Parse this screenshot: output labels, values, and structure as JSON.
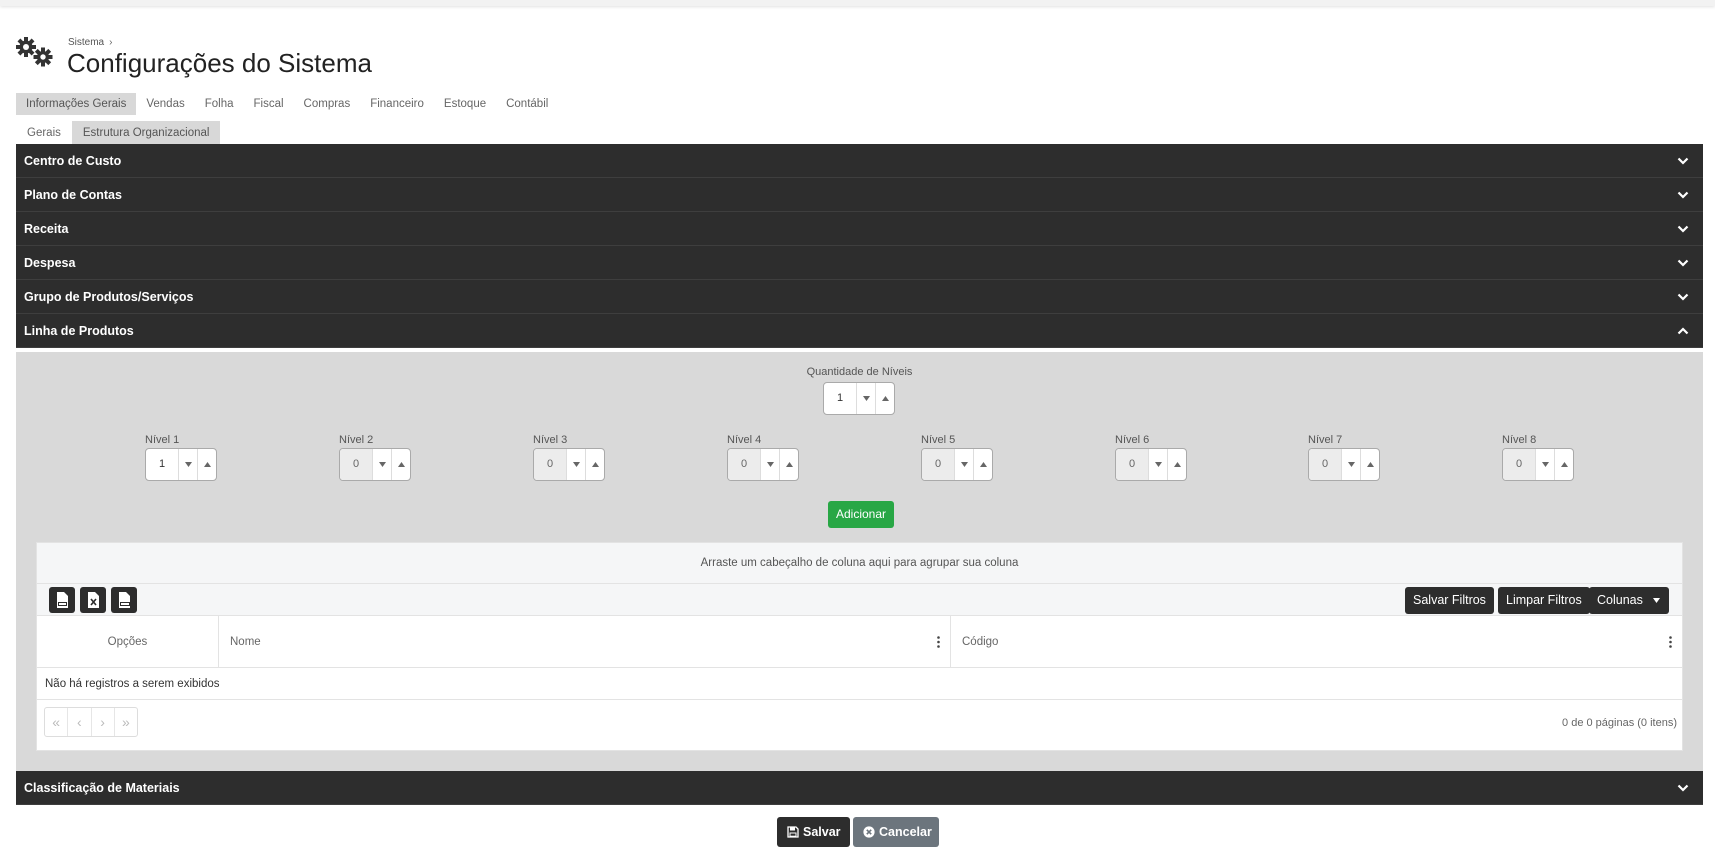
{
  "header": {
    "breadcrumb": "Sistema",
    "breadcrumb_sep": "›",
    "title": "Configurações do Sistema"
  },
  "tabs": [
    "Informações Gerais",
    "Vendas",
    "Folha",
    "Fiscal",
    "Compras",
    "Financeiro",
    "Estoque",
    "Contábil"
  ],
  "subtabs": [
    "Gerais",
    "Estrutura Organizacional"
  ],
  "sections": [
    "Centro de Custo",
    "Plano de Contas",
    "Receita",
    "Despesa",
    "Grupo de Produtos/Serviços",
    "Linha de Produtos"
  ],
  "last_section": "Classificação de Materiais",
  "linha": {
    "qty_label": "Quantidade de Níveis",
    "qty_value": "1",
    "levels": [
      {
        "label": "Nível 1",
        "value": "1"
      },
      {
        "label": "Nível 2",
        "value": "0"
      },
      {
        "label": "Nível 3",
        "value": "0"
      },
      {
        "label": "Nível 4",
        "value": "0"
      },
      {
        "label": "Nível 5",
        "value": "0"
      },
      {
        "label": "Nível 6",
        "value": "0"
      },
      {
        "label": "Nível 7",
        "value": "0"
      },
      {
        "label": "Nível 8",
        "value": "0"
      }
    ],
    "add_label": "Adicionar"
  },
  "grid": {
    "group_hint": "Arraste um cabeçalho de coluna aqui para agrupar sua coluna",
    "save_filters": "Salvar Filtros",
    "clear_filters": "Limpar Filtros",
    "columns_btn": "Colunas",
    "columns": [
      "Opções",
      "Nome",
      "Código"
    ],
    "empty": "Não há registros a serem exibidos",
    "pager_buttons": [
      "«",
      "‹",
      "›",
      "»"
    ],
    "page_info": "0 de 0 páginas (0 itens)"
  },
  "footer": {
    "save": "Salvar",
    "cancel": "Cancelar"
  }
}
